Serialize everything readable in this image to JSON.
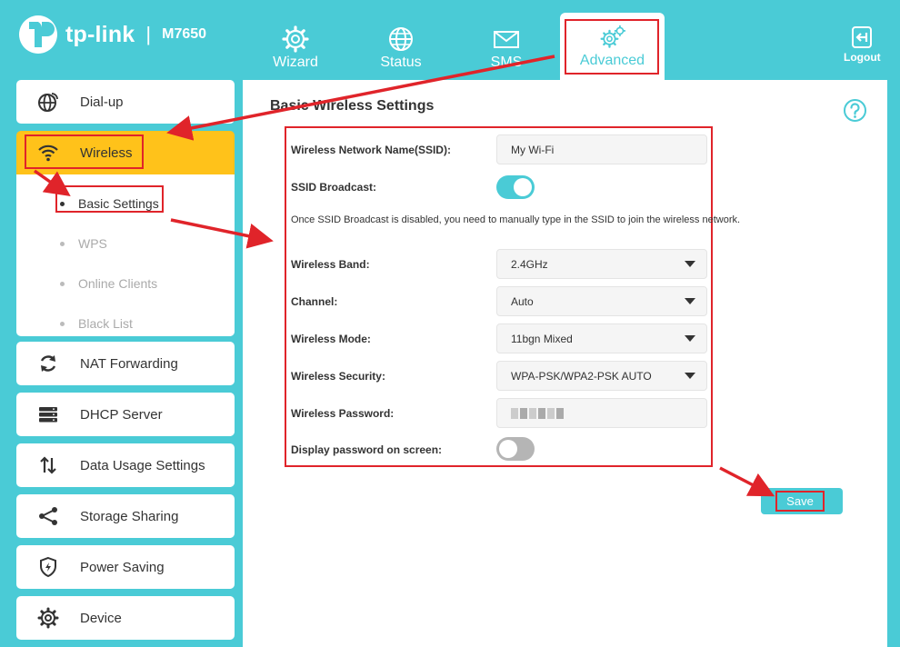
{
  "header": {
    "brand": "tp-link",
    "separator": "|",
    "model": "M7650",
    "tabs": [
      {
        "label": "Wizard",
        "icon": "gear-icon"
      },
      {
        "label": "Status",
        "icon": "globe-icon"
      },
      {
        "label": "SMS",
        "icon": "envelope-icon"
      },
      {
        "label": "Advanced",
        "icon": "gears-icon"
      }
    ],
    "logout": "Logout"
  },
  "sidebar": {
    "items": [
      {
        "label": "Dial-up",
        "icon": "globe-network-icon"
      },
      {
        "label": "Wireless",
        "icon": "wifi-icon"
      },
      {
        "label": "NAT Forwarding",
        "icon": "refresh-icon"
      },
      {
        "label": "DHCP Server",
        "icon": "server-icon"
      },
      {
        "label": "Data Usage Settings",
        "icon": "up-down-arrows-icon"
      },
      {
        "label": "Storage Sharing",
        "icon": "share-icon"
      },
      {
        "label": "Power Saving",
        "icon": "shield-icon"
      },
      {
        "label": "Device",
        "icon": "gear-icon"
      }
    ],
    "wireless_sub": [
      {
        "label": "Basic Settings"
      },
      {
        "label": "WPS"
      },
      {
        "label": "Online Clients"
      },
      {
        "label": "Black List"
      }
    ]
  },
  "main": {
    "title": "Basic Wireless Settings",
    "ssid_label": "Wireless Network Name(SSID):",
    "ssid_value": "My Wi-Fi",
    "broadcast_label": "SSID Broadcast:",
    "broadcast_on": true,
    "hint": "Once SSID Broadcast is disabled, you need to manually type in the SSID to join the wireless network.",
    "band_label": "Wireless Band:",
    "band_value": "2.4GHz",
    "channel_label": "Channel:",
    "channel_value": "Auto",
    "mode_label": "Wireless Mode:",
    "mode_value": "11bgn Mixed",
    "security_label": "Wireless Security:",
    "security_value": "WPA-PSK/WPA2-PSK AUTO",
    "password_label": "Wireless Password:",
    "display_pwd_label": "Display password on screen:",
    "display_pwd_on": false,
    "save_label": "Save"
  },
  "colors": {
    "accent": "#4ACBD6",
    "active_menu": "#FFC21A",
    "annotation_red": "#E0242A"
  }
}
